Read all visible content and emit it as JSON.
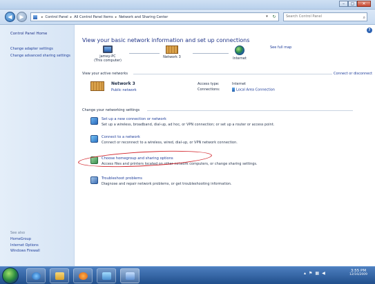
{
  "window": {
    "controls": {
      "minimize": "–",
      "maximize": "▢",
      "close": "✕"
    }
  },
  "address": {
    "crumbs": [
      "Control Panel",
      "All Control Panel Items",
      "Network and Sharing Center"
    ],
    "search_placeholder": "Search Control Panel"
  },
  "left_pane": {
    "home": "Control Panel Home",
    "links": [
      "Change adapter settings",
      "Change advanced sharing settings"
    ],
    "see_also_title": "See also",
    "see_also": [
      "HomeGroup",
      "Internet Options",
      "Windows Firewall"
    ]
  },
  "main": {
    "title": "View your basic network information and set up connections",
    "full_map": "See full map",
    "map": {
      "pc_name": "jamey-PC",
      "pc_sub": "(This computer)",
      "network": "Network 3",
      "internet": "Internet"
    },
    "active_networks_label": "View your active networks",
    "connect_disconnect": "Connect or disconnect",
    "active_network": {
      "name": "Network 3",
      "type": "Public network",
      "access_type_label": "Access type:",
      "access_type_value": "Internet",
      "connections_label": "Connections:",
      "connections_value": "Local Area Connection"
    },
    "change_settings_label": "Change your networking settings",
    "tasks": [
      {
        "link": "Set up a new connection or network",
        "desc": "Set up a wireless, broadband, dial-up, ad hoc, or VPN connection; or set up a router or access point."
      },
      {
        "link": "Connect to a network",
        "desc": "Connect or reconnect to a wireless, wired, dial-up, or VPN network connection."
      },
      {
        "link": "Choose homegroup and sharing options",
        "desc": "Access files and printers located on other network computers, or change sharing settings."
      },
      {
        "link": "Troubleshoot problems",
        "desc": "Diagnose and repair network problems, or get troubleshooting information."
      }
    ]
  },
  "taskbar": {
    "time": "3:55 PM",
    "date": "12/16/2009"
  },
  "colors": {
    "link": "#1e3d9a",
    "highlight": "#d2232a",
    "taskbar": "#214f8c"
  }
}
